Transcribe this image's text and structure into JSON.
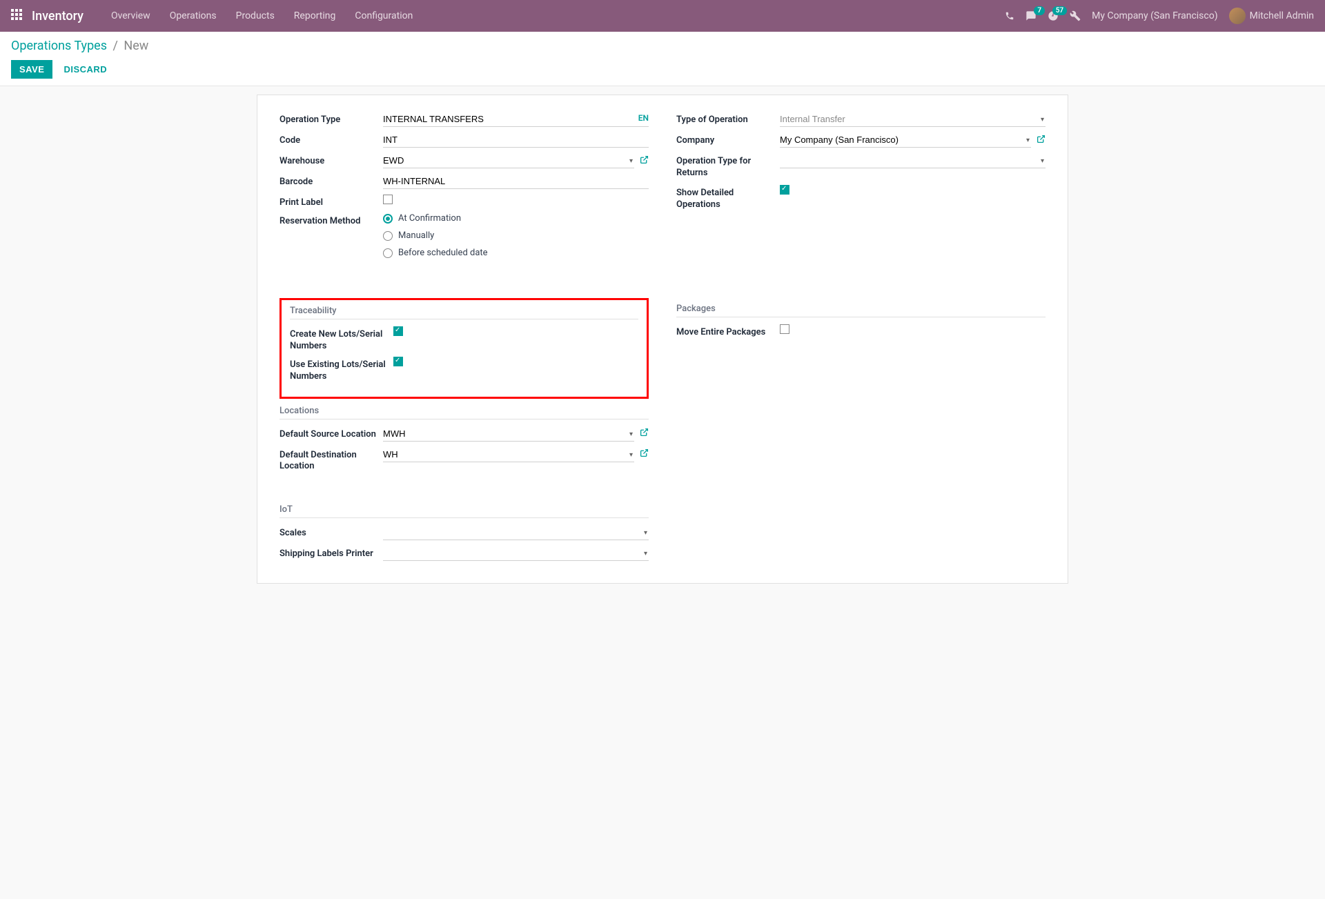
{
  "topnav": {
    "brand": "Inventory",
    "links": [
      "Overview",
      "Operations",
      "Products",
      "Reporting",
      "Configuration"
    ],
    "messages_badge": "7",
    "activities_badge": "57",
    "company": "My Company (San Francisco)",
    "user": "Mitchell Admin"
  },
  "breadcrumb": {
    "parent": "Operations Types",
    "current": "New"
  },
  "buttons": {
    "save": "SAVE",
    "discard": "DISCARD"
  },
  "labels": {
    "operation_type": "Operation Type",
    "code": "Code",
    "warehouse": "Warehouse",
    "barcode": "Barcode",
    "print_label": "Print Label",
    "reservation_method": "Reservation Method",
    "type_of_operation": "Type of Operation",
    "company_label": "Company",
    "op_type_returns": "Operation Type for Returns",
    "show_detailed": "Show Detailed Operations",
    "traceability": "Traceability",
    "create_new_lots": "Create New Lots/Serial Numbers",
    "use_existing_lots": "Use Existing Lots/Serial Numbers",
    "packages": "Packages",
    "move_entire": "Move Entire Packages",
    "locations": "Locations",
    "default_source": "Default Source Location",
    "default_dest": "Default Destination Location",
    "iot": "IoT",
    "scales": "Scales",
    "shipping_printer": "Shipping Labels Printer"
  },
  "values": {
    "operation_type": "INTERNAL TRANSFERS",
    "lang": "EN",
    "code": "INT",
    "warehouse": "EWD",
    "barcode": "WH-INTERNAL",
    "type_of_operation": "Internal Transfer",
    "company": "My Company (San Francisco)",
    "default_source": "MWH",
    "default_dest": "WH"
  },
  "radio": {
    "at_confirmation": "At Confirmation",
    "manually": "Manually",
    "before_scheduled": "Before scheduled date"
  }
}
